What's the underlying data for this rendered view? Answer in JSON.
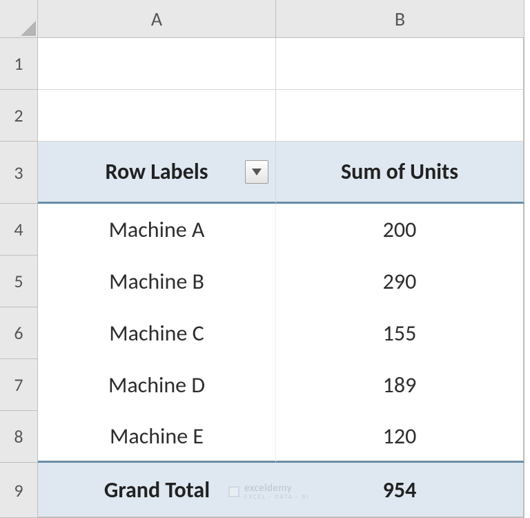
{
  "columns": {
    "A": "A",
    "B": "B"
  },
  "rows": {
    "r1": "1",
    "r2": "2",
    "r3": "3",
    "r4": "4",
    "r5": "5",
    "r6": "6",
    "r7": "7",
    "r8": "8",
    "r9": "9"
  },
  "pivot": {
    "header": {
      "row_labels": "Row Labels",
      "sum_units": "Sum of Units"
    },
    "data": [
      {
        "label": "Machine A",
        "value": "200"
      },
      {
        "label": "Machine B",
        "value": "290"
      },
      {
        "label": "Machine C",
        "value": "155"
      },
      {
        "label": "Machine D",
        "value": "189"
      },
      {
        "label": "Machine E",
        "value": "120"
      }
    ],
    "grand_total": {
      "label": "Grand Total",
      "value": "954"
    }
  },
  "watermark": {
    "brand": "exceldemy",
    "tagline": "EXCEL · DATA · BI"
  }
}
